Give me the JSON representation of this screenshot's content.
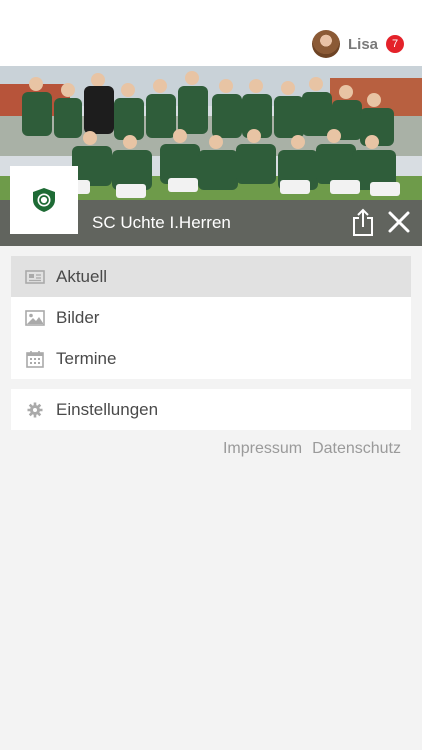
{
  "user": {
    "name": "Lisa",
    "notifications": "7",
    "avatar_icon": "avatar-photo"
  },
  "team": {
    "name": "SC Uchte I.Herren",
    "logo_icon": "club-crest-logo"
  },
  "menu": {
    "items": [
      {
        "label": "Aktuell",
        "icon": "newspaper-icon",
        "active": true
      },
      {
        "label": "Bilder",
        "icon": "image-icon",
        "active": false
      },
      {
        "label": "Termine",
        "icon": "calendar-icon",
        "active": false
      }
    ],
    "settings": {
      "label": "Einstellungen",
      "icon": "gear-icon"
    }
  },
  "footer": {
    "impressum": "Impressum",
    "datenschutz": "Datenschutz"
  },
  "colors": {
    "badge": "#e4222a",
    "hero_bar": "#5f5f5f",
    "active_item": "#e1e1e1",
    "jersey_green": "#2f5d3a"
  }
}
